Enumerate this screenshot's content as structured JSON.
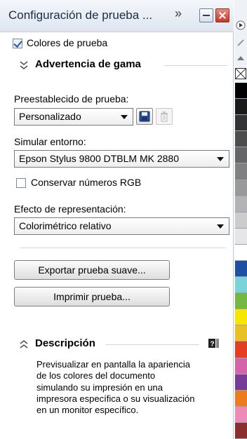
{
  "window": {
    "title": "Configuración de prueba ...",
    "more_glyph": "»"
  },
  "proof_colors": {
    "label": "Colores de prueba",
    "checked": true
  },
  "gamut_section": {
    "title": "Advertencia de gama",
    "expanded": false
  },
  "preset": {
    "label": "Preestablecido de prueba:",
    "value": "Personalizado",
    "save_icon": "save-icon",
    "delete_icon": "trash-icon"
  },
  "environment": {
    "label": "Simular entorno:",
    "value": "Epson Stylus 9800 DTBLM MK 2880"
  },
  "preserve_rgb": {
    "label": "Conservar números RGB",
    "checked": false
  },
  "rendering": {
    "label": "Efecto de representación:",
    "value": "Colorimétrico relativo"
  },
  "buttons": {
    "export": "Exportar prueba suave...",
    "print": "Imprimir prueba..."
  },
  "description_section": {
    "title": "Descripción",
    "expanded": true,
    "text": "Previsualizar en pantalla la apariencia de los colores del documento simulando su impresión en una impresora específica o su visualización en un monitor específico."
  },
  "palette": {
    "colors": [
      "#000000",
      "#1a1a1a",
      "#333333",
      "#4d4d4d",
      "#666666",
      "#808080",
      "#999999",
      "#b3b3b3",
      "#cccccc",
      "#e6e6e6",
      "#ffffff",
      "#1f4fa3",
      "#7ad3d9",
      "#74b843",
      "#f6e600",
      "#e8c126",
      "#e43d1f",
      "#d463a7",
      "#773d96",
      "#ed7c1f",
      "#ec8ab8",
      "#8b2e2e"
    ]
  }
}
